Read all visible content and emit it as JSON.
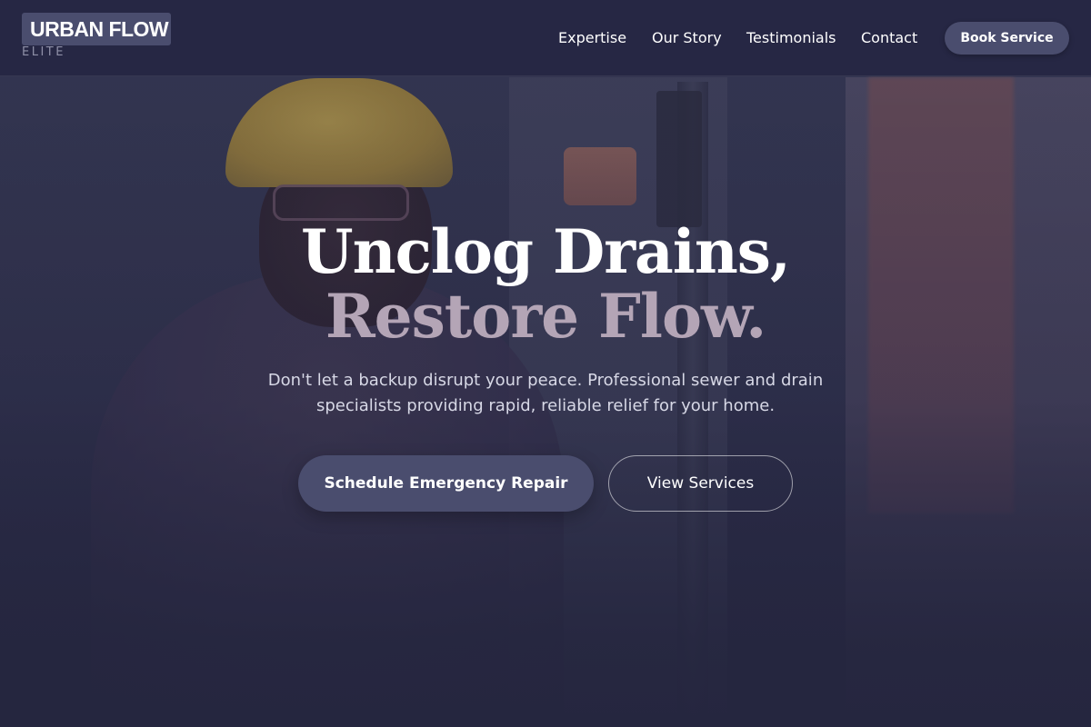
{
  "brand": {
    "name": "URBAN FLOW",
    "tagline": "ELITE"
  },
  "nav": {
    "links": [
      {
        "label": "Expertise"
      },
      {
        "label": "Our Story"
      },
      {
        "label": "Testimonials"
      },
      {
        "label": "Contact"
      }
    ],
    "cta_label": "Book Service"
  },
  "hero": {
    "title_line1": "Unclog Drains,",
    "title_line2": "Restore Flow.",
    "subtitle": "Don't let a backup disrupt your peace. Professional sewer and drain specialists providing rapid, reliable relief for your home.",
    "primary_cta": "Schedule Emergency Repair",
    "secondary_cta": "View Services"
  },
  "colors": {
    "background": "#25263f",
    "navbar": "#242542",
    "button": "#4a4d6e",
    "accent_text": "#b4a5b6",
    "muted_text": "#8f90a8"
  }
}
